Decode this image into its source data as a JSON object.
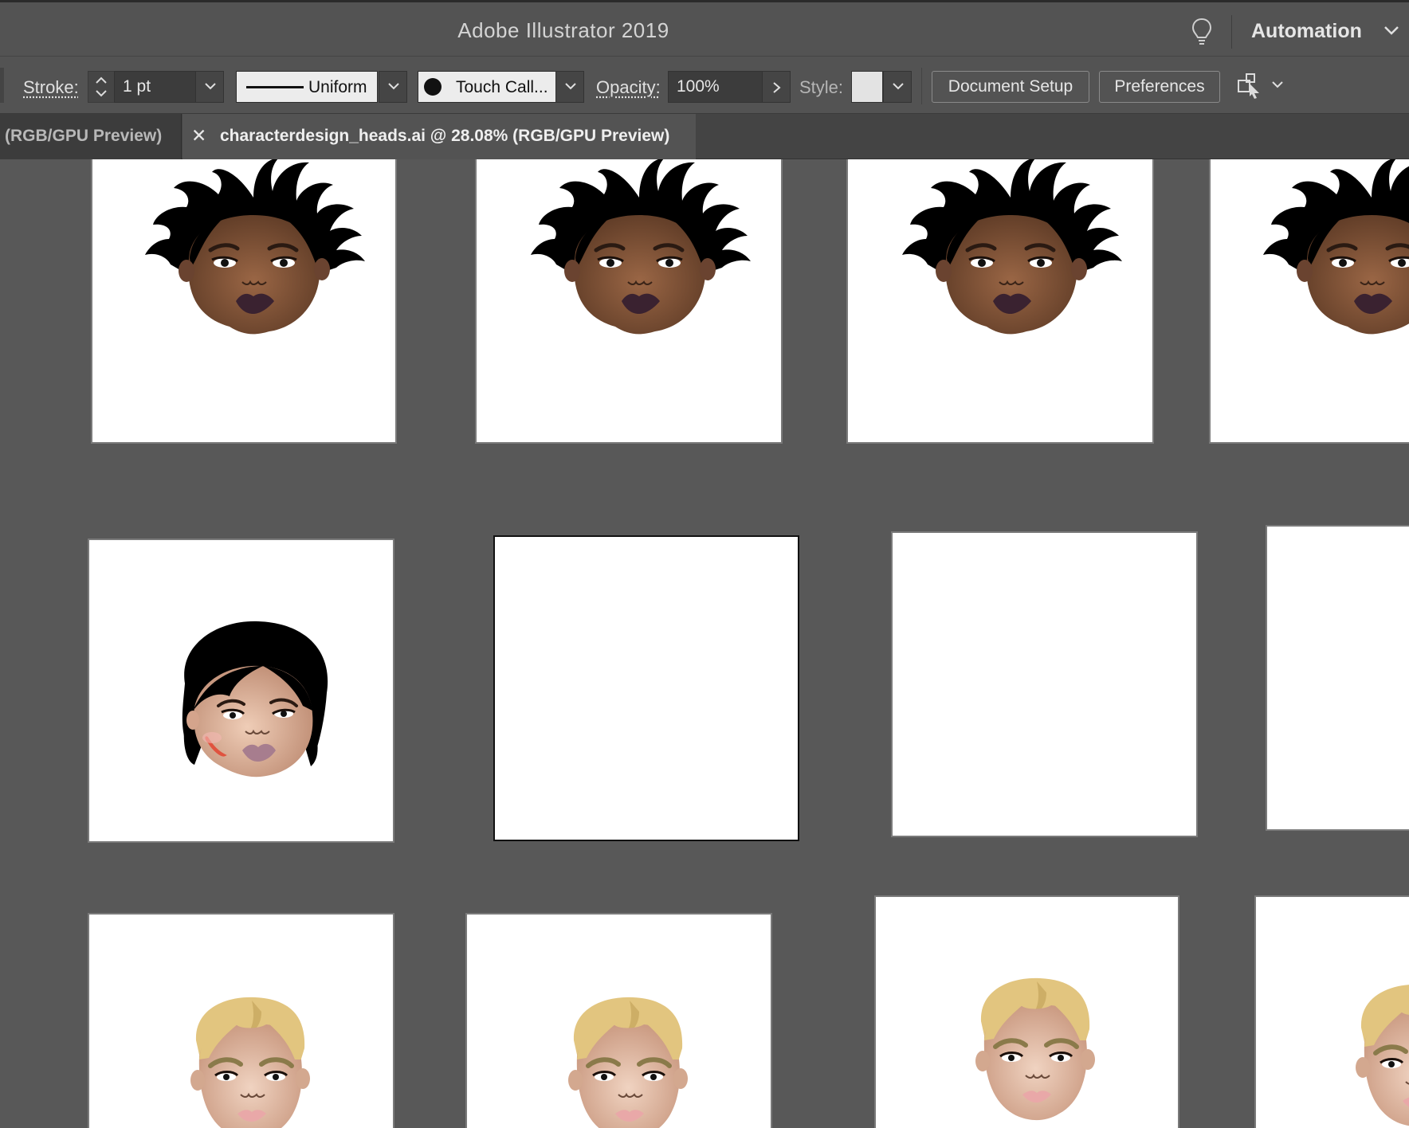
{
  "window": {
    "title": "Adobe Illustrator 2019"
  },
  "workspace": {
    "label": "Automation"
  },
  "control_bar": {
    "stroke_label": "Stroke:",
    "stroke_weight": "1 pt",
    "variable_width_profile": "Uniform",
    "brush_definition": "Touch Call...",
    "opacity_label": "Opacity:",
    "opacity_value": "100%",
    "style_label": "Style:",
    "document_setup_label": "Document Setup",
    "preferences_label": "Preferences"
  },
  "tabs": [
    {
      "label": "(RGB/GPU Preview)",
      "active": false
    },
    {
      "label": "characterdesign_heads.ai @ 28.08% (RGB/GPU Preview)",
      "active": true
    }
  ],
  "colors": {
    "ui_bg": "#535353",
    "canvas_bg": "#585858",
    "dark_skin": "#7b4f35",
    "light_skin": "#d8b3a0",
    "blond_hair": "#e2c57f",
    "hair_black": "#000000",
    "lips_dark": "#3a2230",
    "lips_pink": "#e9a8a8",
    "scar": "#e0533f"
  },
  "icons": [
    "lightbulb-icon",
    "chevron-down-icon",
    "stepper-icon",
    "close-icon",
    "chevron-right-icon",
    "arrange-icon"
  ],
  "artboards": [
    {
      "row": 1,
      "content": "head-curly-neutral"
    },
    {
      "row": 1,
      "content": "head-curly-frown"
    },
    {
      "row": 1,
      "content": "head-curly-smile"
    },
    {
      "row": 1,
      "content": "head-curly-neutral"
    },
    {
      "row": 2,
      "content": "head-bob-scar"
    },
    {
      "row": 2,
      "content": "empty",
      "selected": true
    },
    {
      "row": 2,
      "content": "empty"
    },
    {
      "row": 2,
      "content": "empty"
    },
    {
      "row": 3,
      "content": "head-blond"
    },
    {
      "row": 3,
      "content": "head-blond"
    },
    {
      "row": 3,
      "content": "head-blond"
    },
    {
      "row": 3,
      "content": "head-blond"
    }
  ]
}
